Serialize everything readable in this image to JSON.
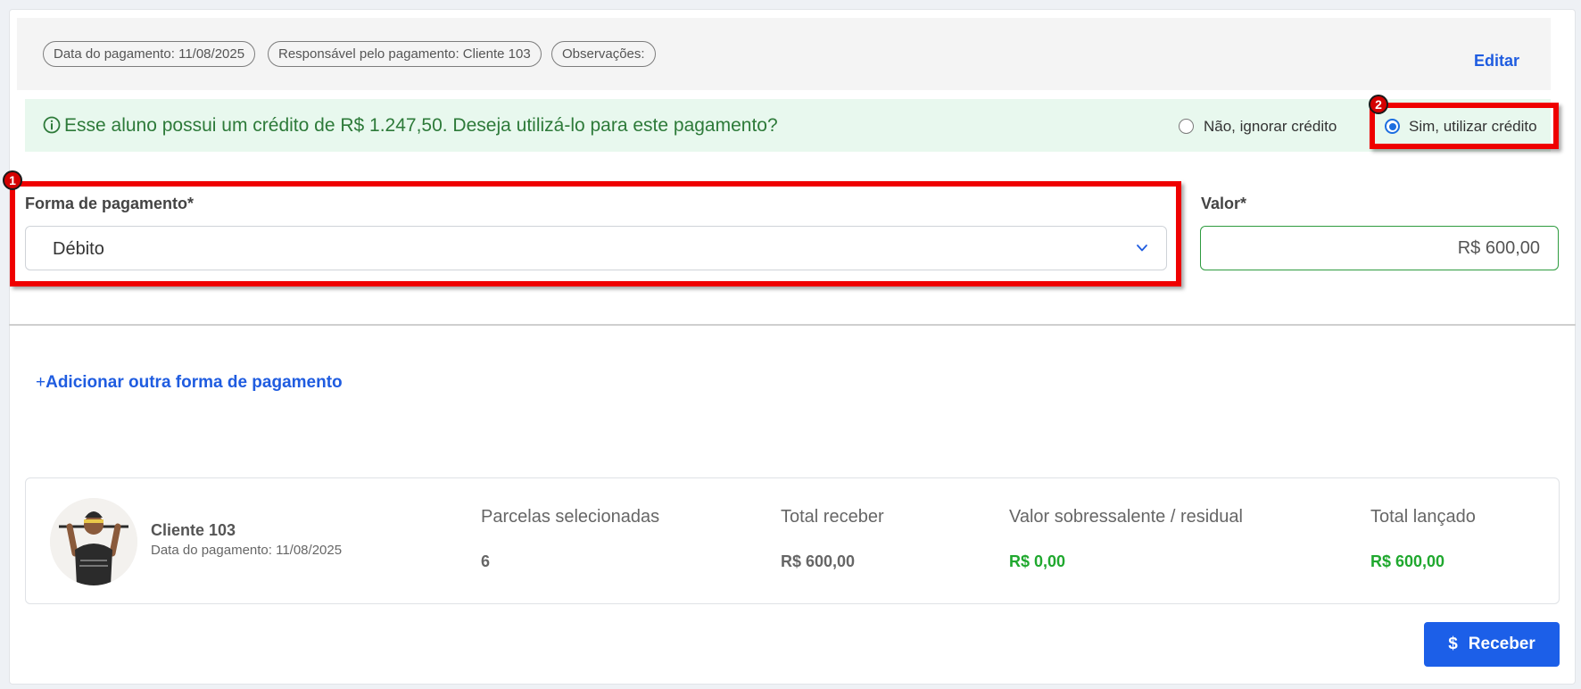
{
  "header": {
    "chips": [
      "Data do pagamento: 11/08/2025",
      "Responsável pelo pagamento: Cliente 103",
      "Observações:"
    ],
    "edit_label": "Editar"
  },
  "credit": {
    "message": "Esse aluno possui um crédito de R$ 1.247,50. Deseja utilizá-lo para este pagamento?",
    "option_no": "Não, ignorar crédito",
    "option_yes": "Sim, utilizar crédito",
    "selected": "yes"
  },
  "annotations": [
    "1",
    "2"
  ],
  "form": {
    "payment_method_label": "Forma de pagamento*",
    "payment_method_value": "Débito",
    "amount_label": "Valor*",
    "amount_value": "R$ 600,00"
  },
  "add_payment_label": "Adicionar outra forma de pagamento",
  "add_payment_plus": "+",
  "summary": {
    "client_name": "Cliente 103",
    "client_date": "Data do pagamento: 11/08/2025",
    "stats": [
      {
        "label": "Parcelas selecionadas",
        "value": "6",
        "color": "#666666"
      },
      {
        "label": "Total receber",
        "value": "R$ 600,00",
        "color": "#666666"
      },
      {
        "label": "Valor sobressalente / residual",
        "value": "R$ 0,00",
        "color": "#1fa82e"
      },
      {
        "label": "Total lançado",
        "value": "R$ 600,00",
        "color": "#1fa82e"
      }
    ]
  },
  "receive_label": "Receber",
  "colors": {
    "accent": "#1c5fe8",
    "success": "#1fa82e",
    "annotation_red": "#ef0000"
  }
}
